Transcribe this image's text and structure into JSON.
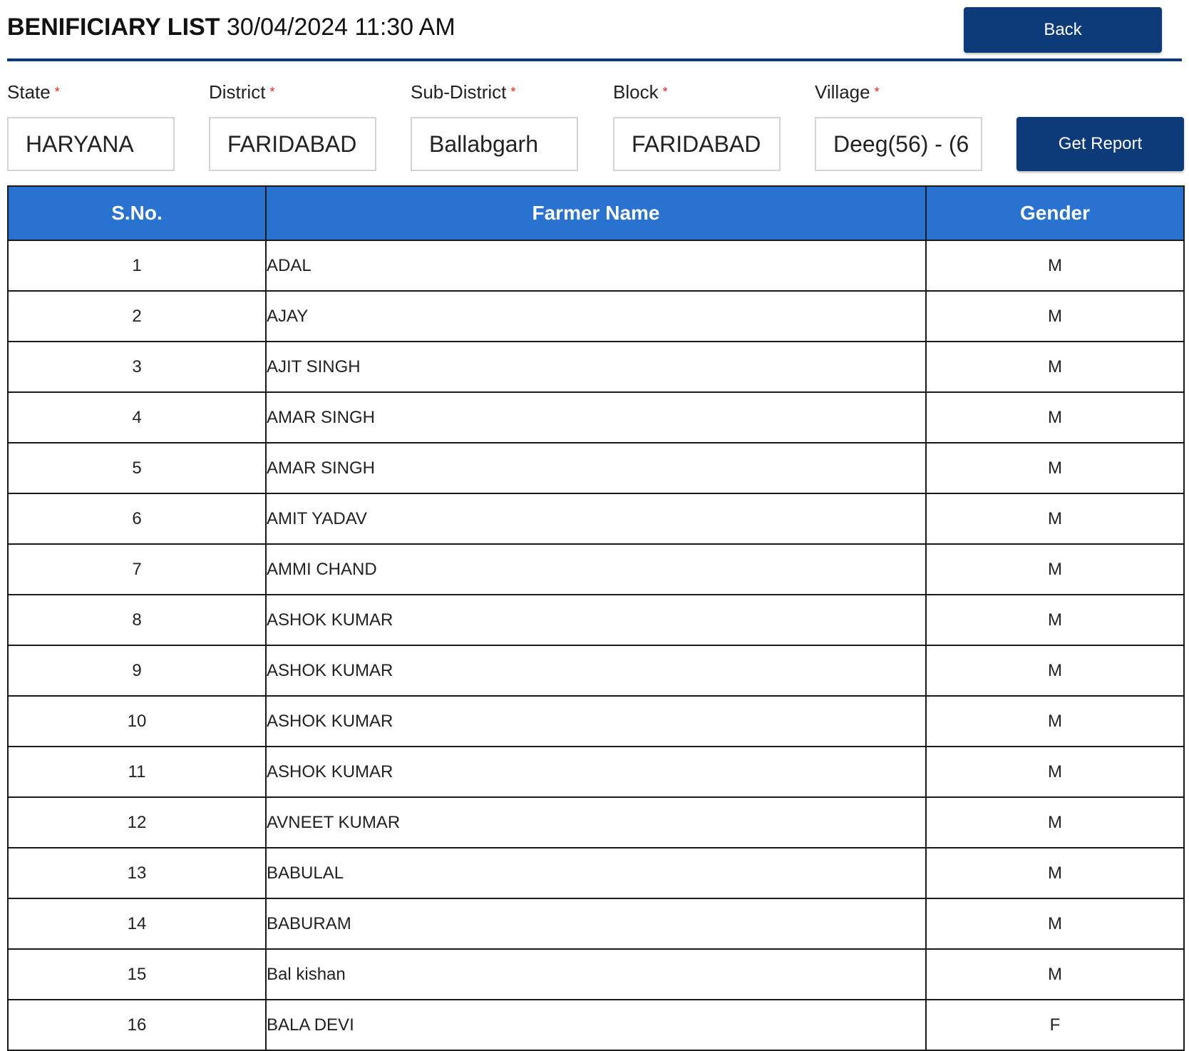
{
  "header": {
    "title": "BENIFICIARY LIST",
    "datetime": "30/04/2024 11:30 AM",
    "back_label": "Back"
  },
  "filters": [
    {
      "label": "State",
      "value": "HARYANA"
    },
    {
      "label": "District",
      "value": "FARIDABAD"
    },
    {
      "label": "Sub-District",
      "value": "Ballabgarh"
    },
    {
      "label": "Block",
      "value": "FARIDABAD"
    },
    {
      "label": "Village",
      "value": "Deeg(56) - (6"
    }
  ],
  "required_mark": "*",
  "get_report_label": "Get Report",
  "table": {
    "columns": [
      "S.No.",
      "Farmer Name",
      "Gender"
    ],
    "rows": [
      {
        "sno": "1",
        "name": "ADAL",
        "gender": "M"
      },
      {
        "sno": "2",
        "name": "AJAY",
        "gender": "M"
      },
      {
        "sno": "3",
        "name": "AJIT SINGH",
        "gender": "M"
      },
      {
        "sno": "4",
        "name": "AMAR SINGH",
        "gender": "M"
      },
      {
        "sno": "5",
        "name": "AMAR SINGH",
        "gender": "M"
      },
      {
        "sno": "6",
        "name": "AMIT YADAV",
        "gender": "M"
      },
      {
        "sno": "7",
        "name": "AMMI CHAND",
        "gender": "M"
      },
      {
        "sno": "8",
        "name": "ASHOK KUMAR",
        "gender": "M"
      },
      {
        "sno": "9",
        "name": "ASHOK KUMAR",
        "gender": "M"
      },
      {
        "sno": "10",
        "name": "ASHOK KUMAR",
        "gender": "M"
      },
      {
        "sno": "11",
        "name": "ASHOK KUMAR",
        "gender": "M"
      },
      {
        "sno": "12",
        "name": "AVNEET KUMAR",
        "gender": "M"
      },
      {
        "sno": "13",
        "name": "BABULAL",
        "gender": "M"
      },
      {
        "sno": "14",
        "name": "BABURAM",
        "gender": "M"
      },
      {
        "sno": "15",
        "name": "Bal kishan",
        "gender": "M"
      },
      {
        "sno": "16",
        "name": "BALA DEVI",
        "gender": "F"
      }
    ]
  },
  "colors": {
    "primary": "#0d3a78",
    "table_header": "#2a72d0",
    "required": "#e02424"
  }
}
